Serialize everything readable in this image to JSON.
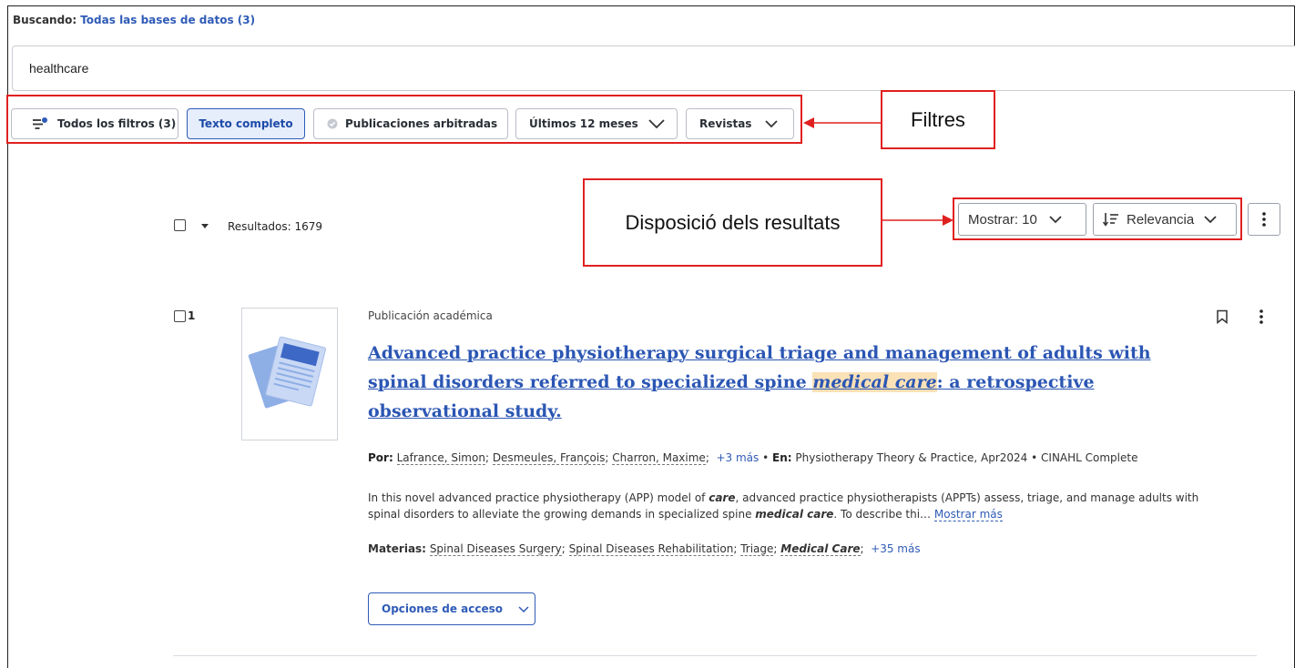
{
  "search": {
    "searching_label": "Buscando:",
    "database_link": "Todas las bases de datos (3)",
    "query_value": "healthcare"
  },
  "filters": {
    "all_filters": "Todos los filtros (3)",
    "full_text": "Texto completo",
    "peer_reviewed": "Publicaciones arbitradas",
    "last_12_months": "Últimos 12 meses",
    "journals": "Revistas"
  },
  "annotations": {
    "filters_callout": "Filtres",
    "results_layout_callout": "Disposició dels resultats"
  },
  "results_bar": {
    "results_label": "Resultados: 1679",
    "show_label": "Mostrar: 10",
    "sort_label": "Relevancia"
  },
  "result": {
    "number": "1",
    "type": "Publicación académica",
    "title_before": "Advanced practice physiotherapy surgical triage and management of adults with spinal disorders referred to specialized spine ",
    "title_highlight": "medical care",
    "title_after": ": a retrospective observational study.",
    "by_label": "Por:",
    "author_1": "Lafrance, Simon",
    "author_2": "Desmeules, François",
    "author_3": "Charron, Maxime",
    "more_authors": "+3 más",
    "in_label": "En:",
    "source": "Physiotherapy Theory & Practice, Apr2024 • CINAHL Complete",
    "abstract_1": "In this novel advanced practice physiotherapy (APP) model of ",
    "abstract_b1": "care",
    "abstract_2": ", advanced practice physiotherapists (APPTs) assess, triage, and manage adults with spinal disorders to alleviate the growing demands in specialized spine ",
    "abstract_b2": "medical care",
    "abstract_3": ". To describe thi…",
    "show_more": "Mostrar más",
    "subjects_label": "Materias:",
    "subject_1": "Spinal Diseases Surgery",
    "subject_2": "Spinal Diseases Rehabilitation",
    "subject_3": "Triage",
    "subject_4": "Medical Care",
    "more_subjects": "+35 más",
    "access_options": "Opciones de acceso"
  },
  "colors": {
    "link_blue": "#2f5bb7",
    "annotation_red": "#e02020",
    "highlight": "#fbe1b6"
  }
}
